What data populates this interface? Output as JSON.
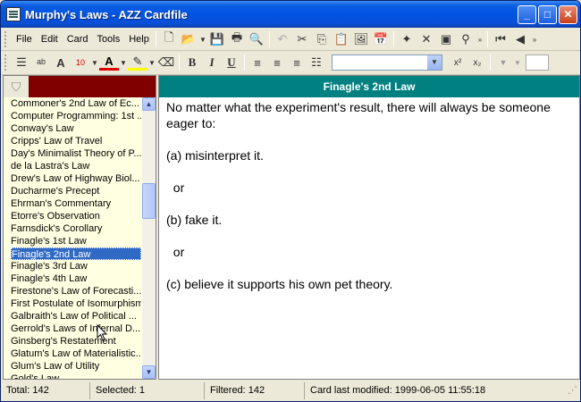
{
  "window": {
    "title": "Murphy's Laws - AZZ Cardfile"
  },
  "titlebar_buttons": {
    "minimize": "_",
    "maximize": "□",
    "close": "✕"
  },
  "menu": [
    "File",
    "Edit",
    "Card",
    "Tools",
    "Help"
  ],
  "format_toolbar": {
    "font_size": "10",
    "font_combo_value": ""
  },
  "list": {
    "items": [
      "Commoner's 2nd Law of Ec...",
      "Computer Programming: 1st ...",
      "Conway's Law",
      "Cripps' Law of Travel",
      "Day's Minimalist Theory of P...",
      "de la Lastra's Law",
      "Drew's Law of Highway Biol...",
      "Ducharme's Precept",
      "Ehrman's Commentary",
      "Etorre's Observation",
      "Farnsdick's Corollary",
      "Finagle's 1st Law",
      "Finagle's 2nd Law",
      "Finagle's 3rd Law",
      "Finagle's 4th Law",
      "Firestone's Law of Forecasti...",
      "First Postulate of Isomurphism",
      "Galbraith's Law of Political ...",
      "Gerrold's Laws of Infernal D...",
      "Ginsberg's Restatement",
      "Glatum's Law of Materialistic...",
      "Glum's Law of Utility",
      "Gold's Law"
    ],
    "selected_index": 12
  },
  "card": {
    "title": "Finagle's 2nd Law",
    "lines": [
      "No matter what the experiment's result, there will always be someone eager to:",
      "",
      "(a) misinterpret it.",
      "",
      "  or",
      "",
      "(b) fake it.",
      "",
      "  or",
      "",
      "(c) believe it supports his own pet theory."
    ]
  },
  "status": {
    "total": "Total: 142",
    "selected": "Selected: 1",
    "filtered": "Filtered: 142",
    "modified": "Card last modified: 1999-06-05  11:55:18"
  },
  "colors": {
    "title_bar": "#0054e3",
    "card_header": "#008080",
    "list_bg": "#ffffe1",
    "filter_bg": "#800000",
    "selection": "#316ac5"
  }
}
